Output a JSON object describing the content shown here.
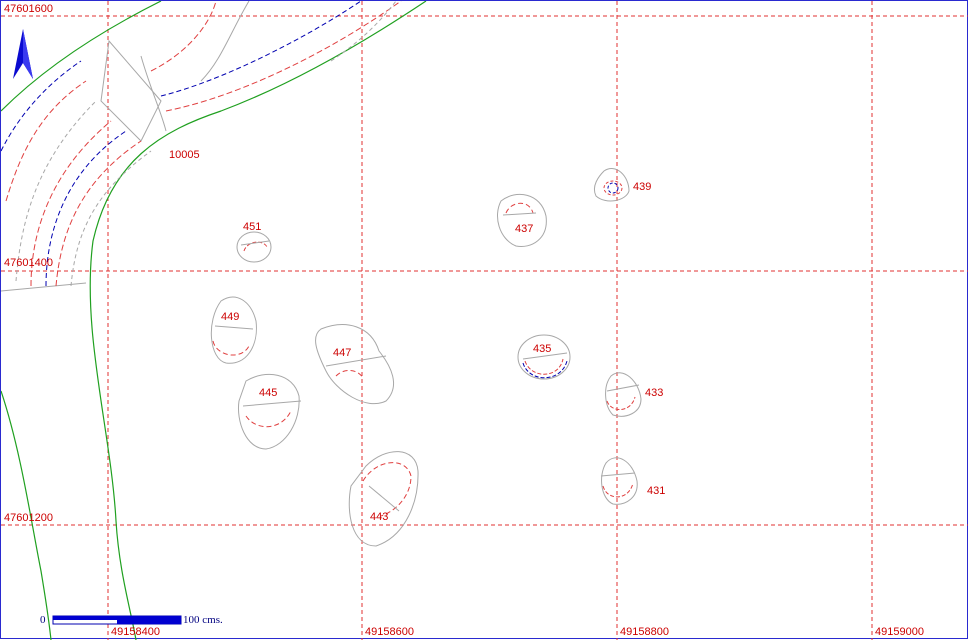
{
  "grid": {
    "y_labels": [
      "47601600",
      "47601400",
      "47601200"
    ],
    "x_labels": [
      "49158400",
      "49158600",
      "49158800",
      "49159000"
    ]
  },
  "features": {
    "f10005": "10005",
    "f451": "451",
    "f449": "449",
    "f447": "447",
    "f445": "445",
    "f443": "443",
    "f437": "437",
    "f439": "439",
    "f435": "435",
    "f433": "433",
    "f431": "431"
  },
  "scale_bar": {
    "start_label": "0",
    "end_label": "100 cms."
  },
  "colors": {
    "grid": "#e03030",
    "outline": "#a8a8a8",
    "contour_red": "#e04040",
    "contour_blue": "#0000b0",
    "boundary_green": "#20a020",
    "label": "#cc0000",
    "north_arrow": "#0a0ad0"
  },
  "icons": {
    "north": "north-arrow-icon"
  }
}
